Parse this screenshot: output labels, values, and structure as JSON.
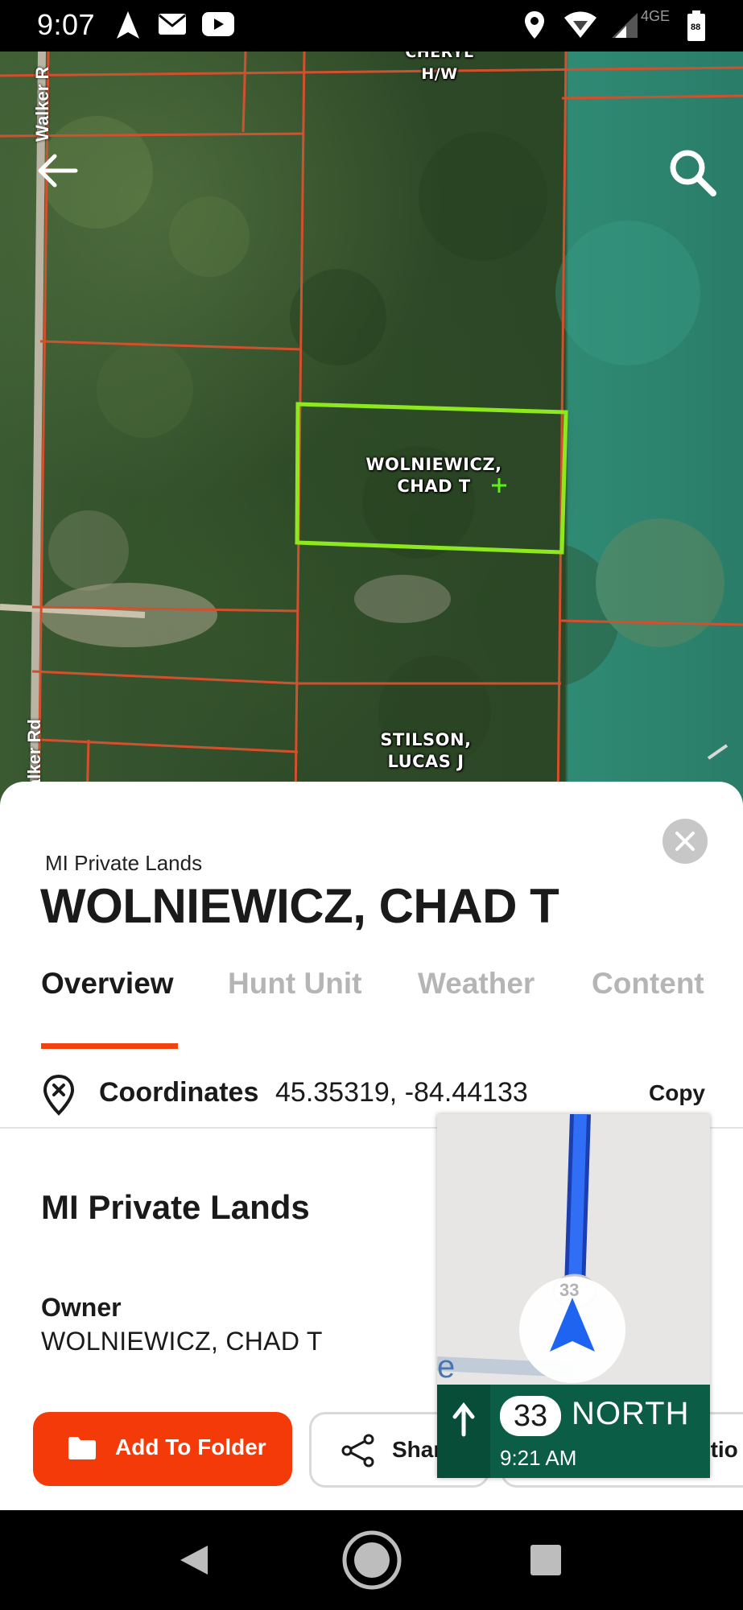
{
  "status_bar": {
    "time": "9:07",
    "network": "4GE",
    "battery": "88",
    "icons": [
      "navigation-icon",
      "gmail-icon",
      "youtube-icon",
      "location-icon",
      "wifi-icon",
      "signal-icon",
      "battery-icon"
    ]
  },
  "map": {
    "labels": {
      "top_parcel": "CHERYL\nH/W",
      "selected_parcel": "WOLNIEWICZ,\nCHAD T",
      "south_parcel": "STILSON,\nLUCAS J",
      "road_top": "Walker R",
      "road_bottom": "alker Rd"
    },
    "colors": {
      "parcel_lines": "#d2502e",
      "selected_parcel": "#8de81e"
    }
  },
  "sheet": {
    "subtitle": "MI Private Lands",
    "title": "WOLNIEWICZ, CHAD T",
    "tabs": [
      "Overview",
      "Hunt Unit",
      "Weather",
      "Content"
    ],
    "active_tab": "Overview",
    "coordinates": {
      "label": "Coordinates",
      "value": "45.35319, -84.44133",
      "copy_label": "Copy"
    },
    "section_title": "MI Private Lands",
    "owner": {
      "label": "Owner",
      "value": "WOLNIEWICZ, CHAD T"
    },
    "buttons": {
      "add_to_folder": "Add To Folder",
      "share": "Shar",
      "directions": "ctio"
    },
    "accent_color": "#f53a0a"
  },
  "nav_overlay": {
    "route_marker": "33",
    "route_number": "33",
    "direction": "NORTH",
    "eta": "9:21 AM",
    "cue_text": "e",
    "colors": {
      "banner": "#0b5e45",
      "route": "#1d4fd8"
    }
  }
}
